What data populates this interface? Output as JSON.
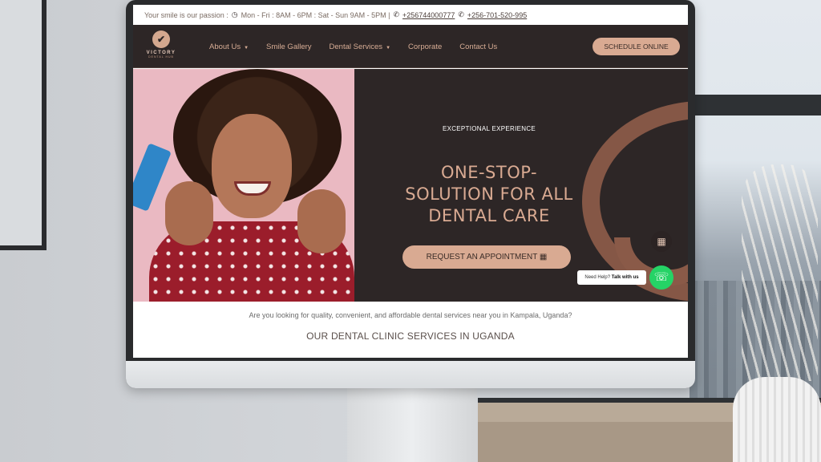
{
  "topbar": {
    "passion_text": "Your smile is our passion :",
    "hours": "Mon - Fri : 8AM - 6PM : Sat - Sun 9AM - 5PM |",
    "phone_1": "+256744000777",
    "phone_2": "+256-701-520-995"
  },
  "logo": {
    "name": "VICTORY",
    "sub": "DENTAL HUB"
  },
  "nav": {
    "items": [
      {
        "label": "About Us",
        "has_dropdown": true
      },
      {
        "label": "Smile Gallery",
        "has_dropdown": false
      },
      {
        "label": "Dental Services",
        "has_dropdown": true
      },
      {
        "label": "Corporate",
        "has_dropdown": false
      },
      {
        "label": "Contact Us",
        "has_dropdown": false
      }
    ],
    "schedule_label": "SCHEDULE ONLINE"
  },
  "hero": {
    "eyebrow": "EXCEPTIONAL EXPERIENCE",
    "title_line_1": "ONE-STOP-",
    "title_line_2": "SOLUTION FOR ALL",
    "title_line_3": "DENTAL CARE",
    "cta_label": "REQUEST AN APPOINTMENT"
  },
  "chat": {
    "help_prefix": "Need Help?",
    "help_action": "Talk with us"
  },
  "intro_text": "Are you looking for quality, convenient, and affordable dental services near you in Kampala, Uganda?",
  "section_title": "OUR DENTAL CLINIC SERVICES IN UGANDA",
  "colors": {
    "nav_bg": "#2d2626",
    "accent": "#d9aa92",
    "whatsapp": "#25d366"
  },
  "icons": {
    "clock": "clock-icon",
    "phone": "phone-icon",
    "calendar": "calendar-icon",
    "whatsapp": "whatsapp-icon",
    "caret": "chevron-down-icon"
  }
}
